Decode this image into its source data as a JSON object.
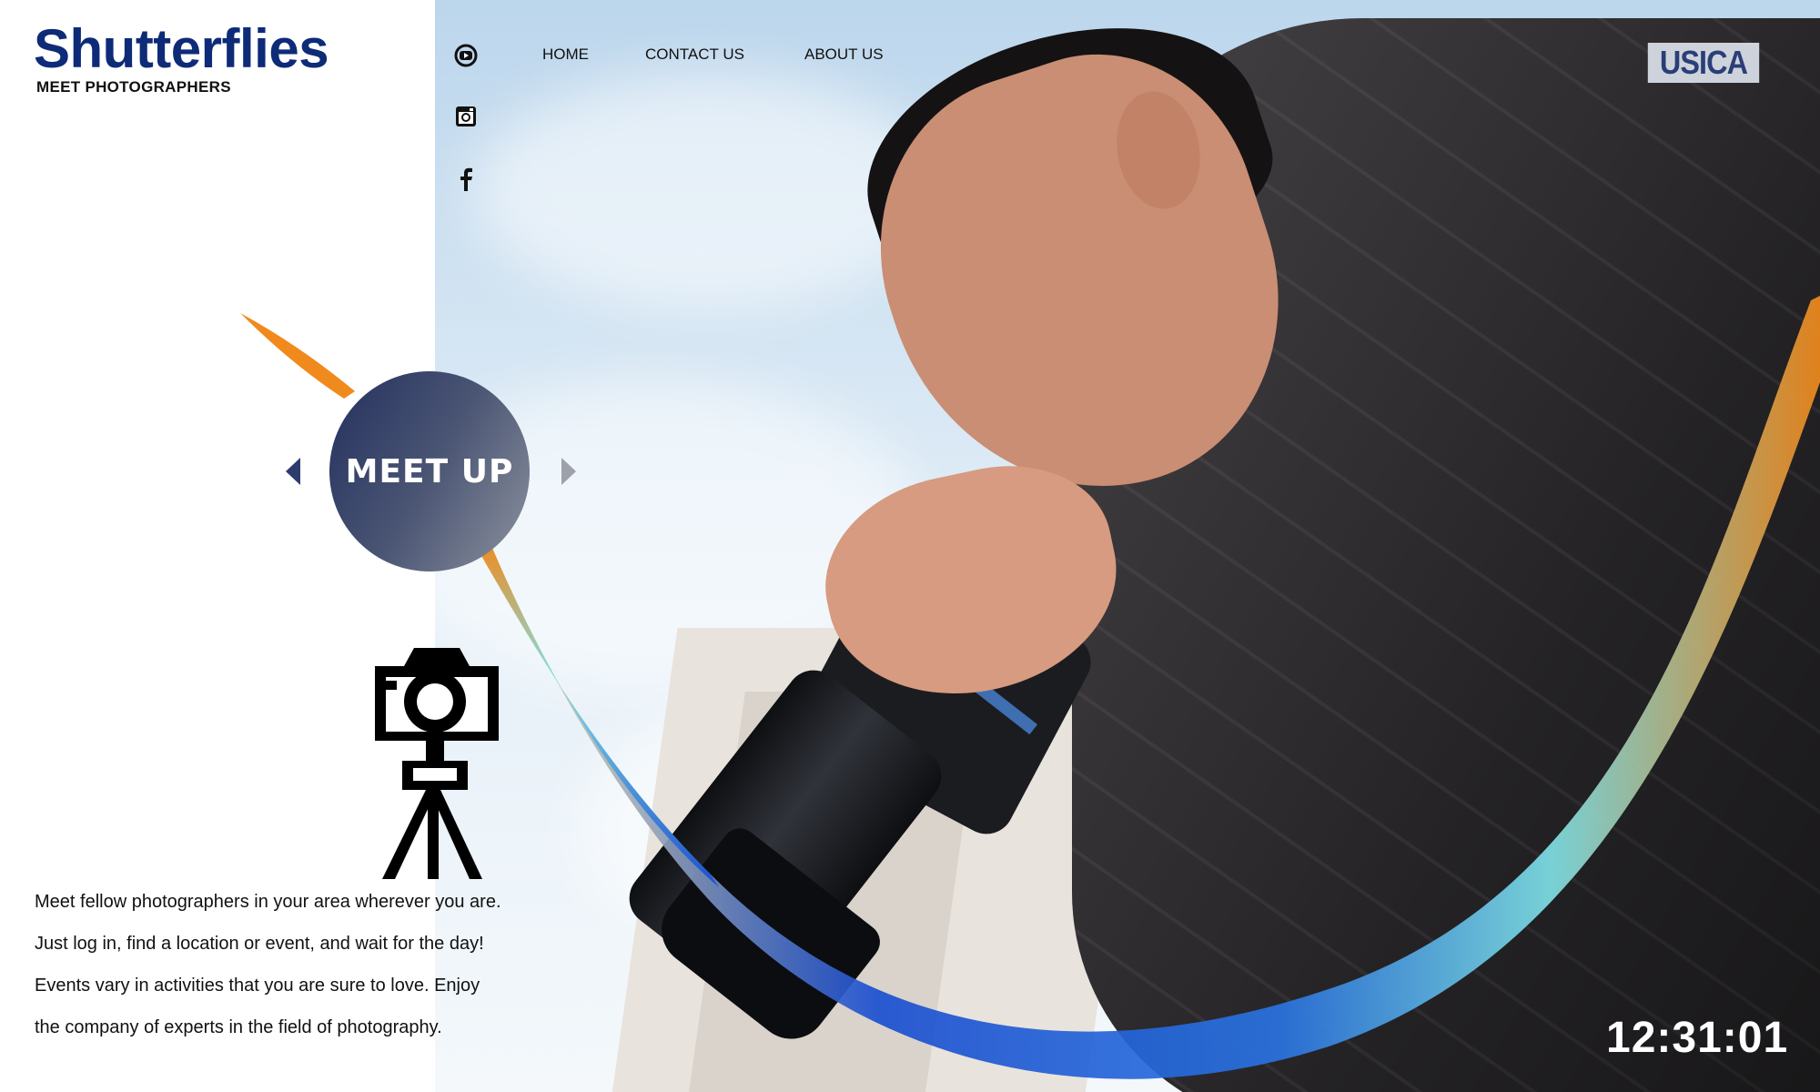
{
  "brand": {
    "title": "Shutterflies",
    "subtitle": "MEET PHOTOGRAPHERS"
  },
  "social": [
    {
      "name": "youtube-icon"
    },
    {
      "name": "instagram-icon"
    },
    {
      "name": "facebook-icon"
    }
  ],
  "nav": {
    "home": "HOME",
    "contact": "CONTACT US",
    "about": "ABOUT US"
  },
  "badge": "USICA",
  "carousel": {
    "label": "MEET UP"
  },
  "description": [
    "Meet fellow photographers in your area wherever you are.",
    "Just log in, find a location or event, and wait for the day!",
    "Events vary in activities that you are sure to love. Enjoy",
    "the company of experts in the field of photography."
  ],
  "clock": "12:31:01",
  "colors": {
    "brand": "#0e2b78",
    "accent_orange": "#f08a1c",
    "accent_blue": "#1b4fd0",
    "accent_cyan": "#7fe0e6"
  },
  "icons": {
    "hero": "camera-tripod-icon",
    "prev": "prev-arrow-icon",
    "next": "next-arrow-icon"
  }
}
